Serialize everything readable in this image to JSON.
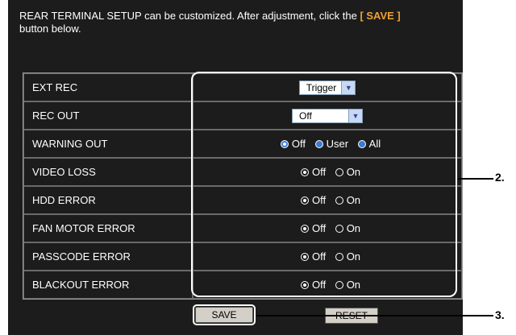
{
  "intro": {
    "text_before": "REAR TERMINAL SETUP can be customized. After adjustment, click the",
    "highlight": "[ SAVE ]",
    "text_after": "button below."
  },
  "rows": [
    {
      "label": "EXT REC",
      "type": "select",
      "value": "Trigger"
    },
    {
      "label": "REC OUT",
      "type": "select",
      "value": "Off"
    },
    {
      "label": "WARNING OUT",
      "type": "radio3",
      "options": [
        "Off",
        "User",
        "All"
      ],
      "selected": "Off"
    },
    {
      "label": "VIDEO LOSS",
      "type": "radio2",
      "options": [
        "Off",
        "On"
      ],
      "selected": "Off"
    },
    {
      "label": "HDD ERROR",
      "type": "radio2",
      "options": [
        "Off",
        "On"
      ],
      "selected": "Off"
    },
    {
      "label": "FAN MOTOR ERROR",
      "type": "radio2",
      "options": [
        "Off",
        "On"
      ],
      "selected": "Off"
    },
    {
      "label": "PASSCODE ERROR",
      "type": "radio2",
      "options": [
        "Off",
        "On"
      ],
      "selected": "Off"
    },
    {
      "label": "BLACKOUT ERROR",
      "type": "radio2",
      "options": [
        "Off",
        "On"
      ],
      "selected": "Off"
    }
  ],
  "buttons": {
    "save": "SAVE",
    "reset": "RESET"
  },
  "callouts": {
    "settings": "2.",
    "save": "3."
  },
  "colors": {
    "highlight": "#f0a030",
    "panel": "#1c1c1c"
  }
}
